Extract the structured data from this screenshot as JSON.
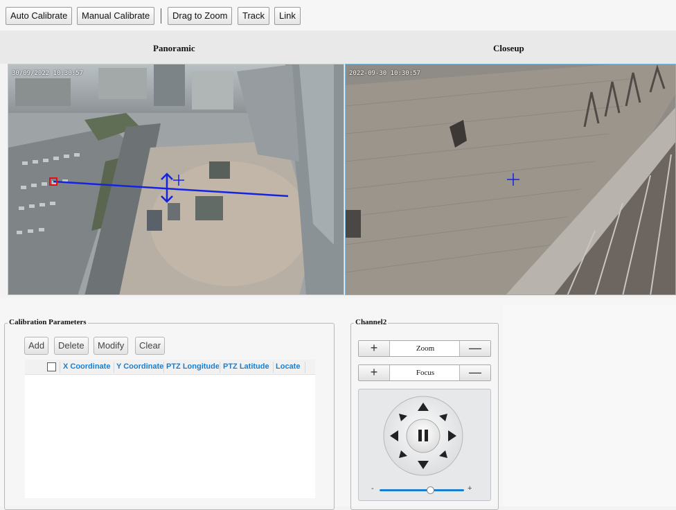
{
  "toolbar": {
    "auto_calibrate": "Auto Calibrate",
    "manual_calibrate": "Manual Calibrate",
    "drag_to_zoom": "Drag to Zoom",
    "track": "Track",
    "link": "Link"
  },
  "views": {
    "panoramic": {
      "title": "Panoramic",
      "osd": "30/09/2022 10:30:57"
    },
    "closeup": {
      "title": "Closeup",
      "osd": "2022-09-30 10:30:57"
    }
  },
  "calibration": {
    "legend": "Calibration Parameters",
    "buttons": {
      "add": "Add",
      "delete": "Delete",
      "modify": "Modify",
      "clear": "Clear"
    },
    "columns": [
      "X Coordinate",
      "Y Coordinate",
      "PTZ Longitude",
      "PTZ Latitude",
      "Locate"
    ],
    "rows": []
  },
  "channel": {
    "legend": "Channel2",
    "zoom_label": "Zoom",
    "focus_label": "Focus",
    "plus_symbol": "+",
    "minus_symbol": "—",
    "speed_min": "-",
    "speed_max": "+",
    "speed_level": 0.6
  },
  "colors": {
    "accent": "#1a7ed0",
    "overlay_line": "#1522e0",
    "marker": "#e0101a"
  }
}
